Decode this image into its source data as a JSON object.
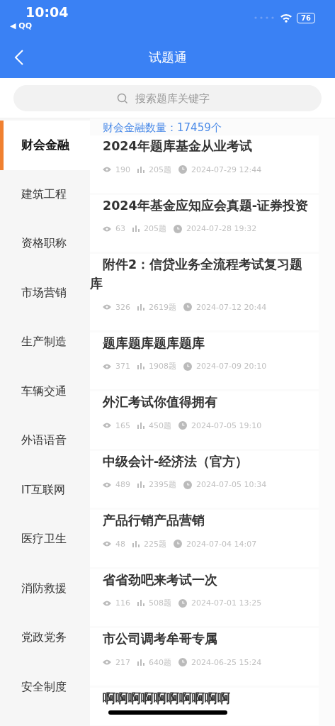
{
  "status_bar": {
    "time": "10:04",
    "back_app": "◀ QQ",
    "battery": "76"
  },
  "header": {
    "title": "试题通"
  },
  "search": {
    "placeholder": "搜索题库关键字"
  },
  "categories": [
    {
      "label": "财会金融",
      "selected": true
    },
    {
      "label": "建筑工程",
      "selected": false
    },
    {
      "label": "资格职称",
      "selected": false
    },
    {
      "label": "市场营销",
      "selected": false
    },
    {
      "label": "生产制造",
      "selected": false
    },
    {
      "label": "车辆交通",
      "selected": false
    },
    {
      "label": "外语语音",
      "selected": false
    },
    {
      "label": "IT互联网",
      "selected": false
    },
    {
      "label": "医疗卫生",
      "selected": false
    },
    {
      "label": "消防救援",
      "selected": false
    },
    {
      "label": "党政党务",
      "selected": false
    },
    {
      "label": "安全制度",
      "selected": false
    }
  ],
  "list": {
    "count_label": "财会金融数量：17459个",
    "items": [
      {
        "title": "2024年题库基金从业考试",
        "views": "190",
        "questions": "205题",
        "date": "2024-07-29 12:44"
      },
      {
        "title": "2024年基金应知应会真题-证券投资",
        "views": "63",
        "questions": "205题",
        "date": "2024-07-28 19:32"
      },
      {
        "title": "附件2：信贷业务全流程考试复习题库",
        "views": "326",
        "questions": "2619题",
        "date": "2024-07-12 20:44"
      },
      {
        "title": "题库题库题库题库",
        "views": "371",
        "questions": "1908题",
        "date": "2024-07-09 20:10"
      },
      {
        "title": "外汇考试你值得拥有",
        "views": "165",
        "questions": "450题",
        "date": "2024-07-05 19:10"
      },
      {
        "title": "中级会计-经济法（官方）",
        "views": "489",
        "questions": "2395题",
        "date": "2024-07-05 10:34"
      },
      {
        "title": "产品行销产品营销",
        "views": "48",
        "questions": "225题",
        "date": "2024-07-04 14:07"
      },
      {
        "title": "省省劲吧来考试一次",
        "views": "116",
        "questions": "508题",
        "date": "2024-07-01 13:25"
      },
      {
        "title": "市公司调考牟哥专属",
        "views": "217",
        "questions": "640题",
        "date": "2024-06-25 15:24"
      },
      {
        "title": "啊啊啊啊啊啊啊啊啊啊"
      }
    ]
  }
}
